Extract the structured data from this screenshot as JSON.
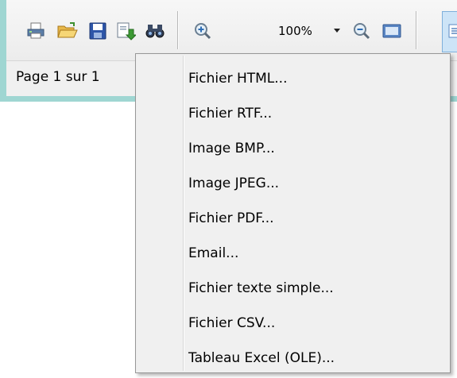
{
  "toolbar": {
    "buttons": [
      {
        "name": "print-icon"
      },
      {
        "name": "open-folder-icon"
      },
      {
        "name": "save-icon"
      },
      {
        "name": "export-icon"
      },
      {
        "name": "find-icon"
      },
      {
        "name": "zoom-in-icon"
      },
      {
        "name": "zoom-out-icon"
      },
      {
        "name": "page-view-icon"
      }
    ],
    "zoom_value": "100%"
  },
  "status": {
    "page_label": "Page 1 sur 1"
  },
  "menu": {
    "items": [
      {
        "label": "Fichier HTML..."
      },
      {
        "label": "Fichier RTF..."
      },
      {
        "label": "Image BMP..."
      },
      {
        "label": "Image JPEG..."
      },
      {
        "label": "Fichier PDF..."
      },
      {
        "label": "Email..."
      },
      {
        "label": "Fichier texte simple..."
      },
      {
        "label": "Fichier CSV..."
      },
      {
        "label": "Tableau Excel (OLE)..."
      }
    ]
  },
  "colors": {
    "frame": "#9fd6d2",
    "toolbar": "#f0f0f0",
    "menu_bg": "#f0f0f0",
    "accent_blue": "#2d6db5"
  }
}
